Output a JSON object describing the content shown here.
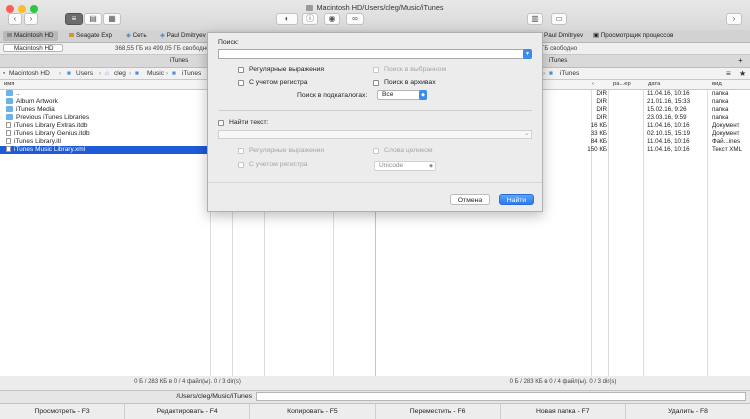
{
  "window": {
    "title": "Macintosh HD/Users/cleg/Music/iTunes"
  },
  "tabs": {
    "left": [
      "Macintosh HD",
      "Seagate Exp",
      "Сеть",
      "Paul Dmitryev"
    ],
    "right": [
      "Paul Dmitryev",
      "Просмотрщик процессов"
    ]
  },
  "left_panel": {
    "drive": "Macintosh HD",
    "drive_info": "368,55 ГБ из 499,05 ГБ свободно",
    "path_title": "iTunes",
    "breadcrumbs": [
      "Macintosh HD",
      "Users",
      "cleg",
      "Music",
      "iTunes"
    ],
    "col_name": "имя",
    "files": [
      {
        "name": "..",
        "type": "folder"
      },
      {
        "name": "Album Artwork",
        "type": "folder"
      },
      {
        "name": "iTunes Media",
        "type": "folder"
      },
      {
        "name": "Previous iTunes Libraries",
        "type": "folder"
      },
      {
        "name": "iTunes Library Extras.itdb",
        "type": "doc"
      },
      {
        "name": "iTunes Library Genius.itdb",
        "type": "doc"
      },
      {
        "name": "iTunes Library.itl",
        "type": "doc"
      },
      {
        "name": "iTunes Music Library.xml",
        "type": "doc"
      }
    ],
    "status": "0 Б / 283 КБ в 0 / 4 файл(ы). 0 / 3 dir(s)"
  },
  "right_panel": {
    "drive_info": "ГБ свободно",
    "path_title": "iTunes",
    "breadcrumb": "iTunes",
    "columns": {
      "ext": "ра...ер",
      "date": "дата",
      "kind": "вид"
    },
    "rows": [
      {
        "size": "DIR",
        "date": "11.04.16, 10:16",
        "kind": "папка"
      },
      {
        "size": "DIR",
        "date": "21.01.16, 15:33",
        "kind": "папка"
      },
      {
        "size": "DIR",
        "date": "15.02.16, 9:26",
        "kind": "папка"
      },
      {
        "size": "DIR",
        "date": "23.03.16, 9:59",
        "kind": "папка"
      },
      {
        "size": "16 КБ",
        "date": "11.04.16, 10:16",
        "kind": "Документ"
      },
      {
        "size": "33 КБ",
        "date": "02.10.15, 15:19",
        "kind": "Документ"
      },
      {
        "size": "84 КБ",
        "date": "11.04.16, 10:16",
        "kind": "Фай...ines"
      },
      {
        "size": "150 КБ",
        "date": "11.04.16, 10:16",
        "kind": "Текст XML"
      }
    ],
    "status": "0 Б / 283 КБ в 0 / 4 файл(ы). 0 / 3 dir(s)"
  },
  "command_line": {
    "path": "/Users/cleg/Music/iTunes"
  },
  "function_keys": [
    "Просмотреть - F3",
    "Редактировать - F4",
    "Копировать - F5",
    "Переместить - F6",
    "Новая папка - F7",
    "Удалить - F8"
  ],
  "dialog": {
    "search_label": "Поиск:",
    "search_value": "",
    "regex": "Регулярные выражения",
    "case": "С учетом регистра",
    "in_selected": "Поиск в выбранном",
    "in_archives": "Поиск в архивах",
    "subdirs_label": "Поиск в подкаталогах:",
    "subdirs_value": "Все",
    "find_text_label": "Найти текст:",
    "text_regex": "Регулярные выражения",
    "text_case": "С учетом регистра",
    "whole_words": "Слова целиком",
    "encoding": "Unicode",
    "cancel": "Отмена",
    "find": "Найти"
  }
}
